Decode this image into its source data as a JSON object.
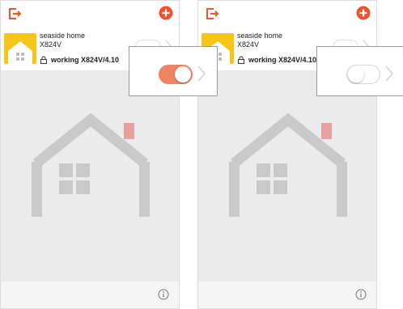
{
  "colors": {
    "accent": "#f0532a",
    "toggle_on": "#ee8463",
    "thumb": "#f5c518",
    "chimney": "#e6a0a0",
    "house": "#c9c9c9"
  },
  "screens": [
    {
      "device": {
        "name": "seaside home",
        "model": "X824V",
        "status": "working X824V/4.10"
      },
      "toggle_state": "on"
    },
    {
      "device": {
        "name": "seaside home",
        "model": "X824V",
        "status": "working X824V/4.10"
      },
      "toggle_state": "off"
    }
  ],
  "icons": {
    "logout": "logout-icon",
    "add": "add-circle-icon",
    "lock": "lock-icon",
    "info": "info-icon",
    "chevron": "chevron-right-icon",
    "house": "house-icon"
  }
}
